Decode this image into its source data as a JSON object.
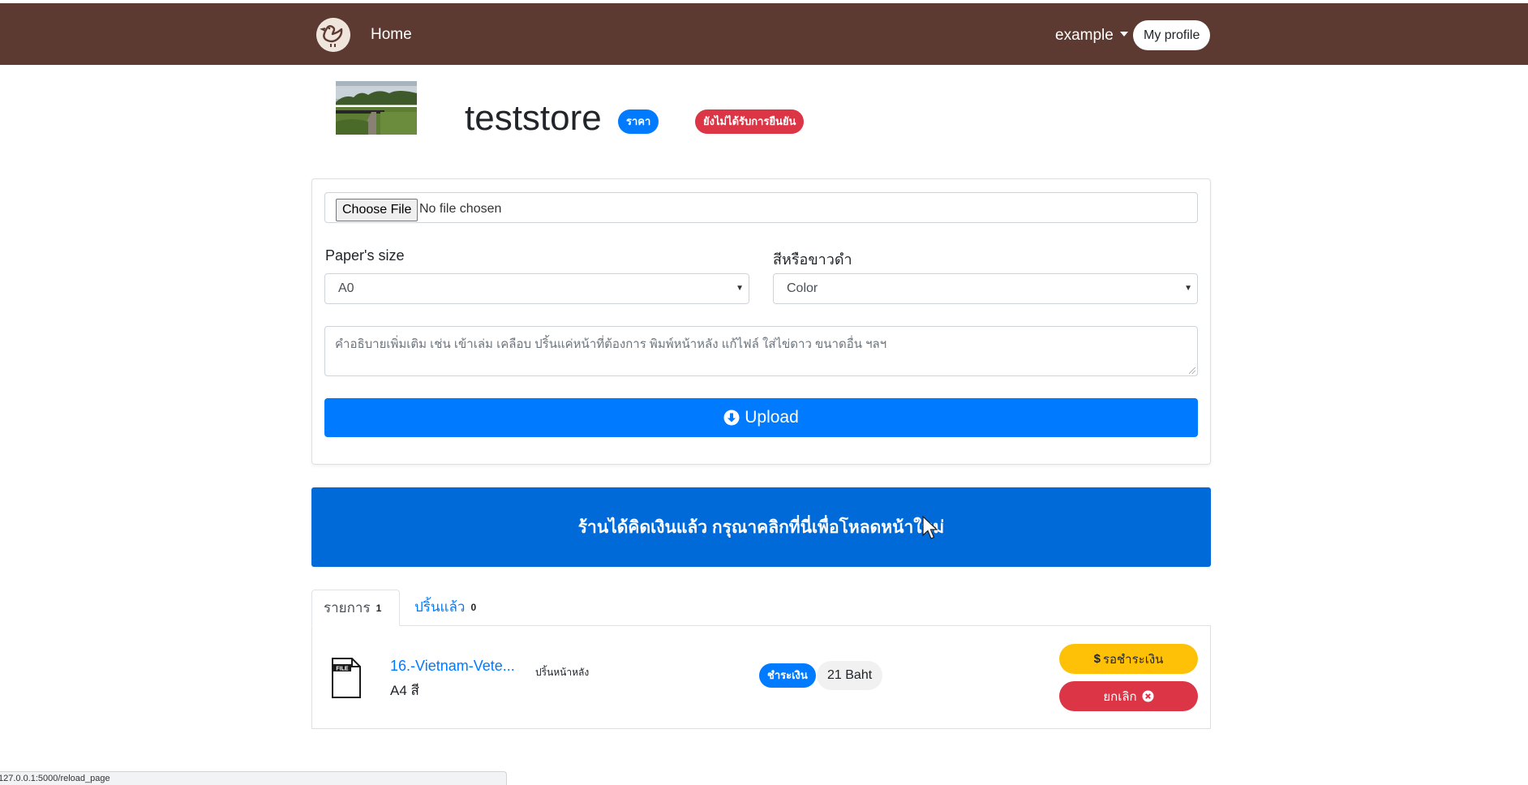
{
  "navbar": {
    "logo_icon": "duck-logo-icon",
    "home_label": "Home",
    "user_label": "example",
    "profile_label": "My profile",
    "bg_color": "#5c3a31"
  },
  "store": {
    "name": "teststore",
    "price_badge": "ราคา",
    "status_badge": "ยังไม่ได้รับการยืนยัน"
  },
  "upload_form": {
    "choose_file_label": "Choose File",
    "no_file_text": "No file chosen",
    "paper_size_label": "Paper's size",
    "paper_size_value": "A0",
    "color_label": "สีหรือขาวดำ",
    "color_value": "Color",
    "description_placeholder": "คำอธิบายเพิ่มเติม เช่น เข้าเล่ม เคลือบ ปริ้นแค่หน้าที่ต้องการ พิมพ์หน้าหลัง  แก้ไฟล์ ใส่ไข่ดาว ขนาดอื่น ฯลฯ",
    "upload_label": "Upload"
  },
  "banner": {
    "text": "ร้านได้คิดเงินแล้ว กรุณาคลิกที่นี่เพื่อโหลดหน้าใหม่"
  },
  "tabs": [
    {
      "label": "รายการ",
      "count": "1"
    },
    {
      "label": "ปริ้นแล้ว",
      "count": "0"
    }
  ],
  "order_item": {
    "file_name": "16.-Vietnam-Vete...",
    "spec": "A4 สี",
    "note": "ปริ้นหน้าหลัง",
    "pay_badge": "ชำระเงิน",
    "price": "21 Baht",
    "wait_button": "รอชำระเงิน",
    "cancel_button": "ยกเลิก"
  },
  "status_bar": {
    "url": "127.0.0.1:5000/reload_page"
  },
  "colors": {
    "primary": "#007bff",
    "danger": "#dc3545",
    "warning": "#ffc107",
    "banner": "#006ad9"
  }
}
